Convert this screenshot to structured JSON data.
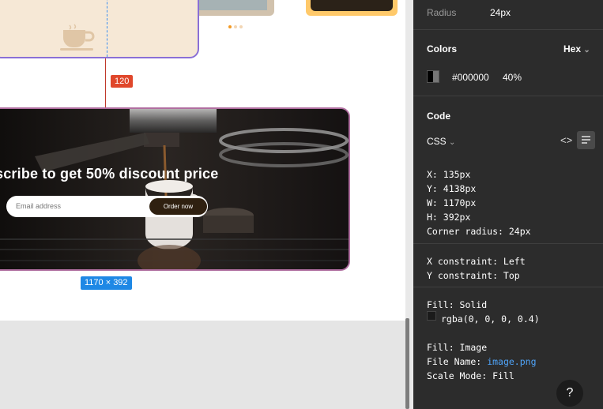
{
  "canvas": {
    "spacing_label": "120",
    "banner": {
      "headline": "scribe to get 50% discount price",
      "email_placeholder": "Email address",
      "button_label": "Order now"
    },
    "dimensions_label": "1170 × 392",
    "carousel_dots": 3
  },
  "inspector": {
    "radius_label": "Radius",
    "radius_value": "24px",
    "colors_title": "Colors",
    "color_format": "Hex",
    "color_hex": "#000000",
    "color_opacity": "40%",
    "code_title": "Code",
    "code_language": "CSS",
    "code_lines": {
      "x": "X: 135px",
      "y": "Y: 4138px",
      "w": "W: 1170px",
      "h": "H: 392px",
      "radius": "Corner radius: 24px",
      "x_constraint": "X constraint: Left",
      "y_constraint": "Y constraint: Top",
      "fill_solid": "Fill: Solid",
      "fill_rgba": "rgba(0, 0, 0, 0.4)",
      "fill_image": "Fill: Image",
      "file_name_label": "File Name:",
      "file_name": "image.png",
      "scale_mode": "Scale Mode: Fill"
    },
    "help_label": "?"
  },
  "colors": {
    "accent_red": "#e0472b",
    "badge_blue": "#1e88e5",
    "panel_bg": "#2c2c2c",
    "link_blue": "#4fa3f7"
  }
}
